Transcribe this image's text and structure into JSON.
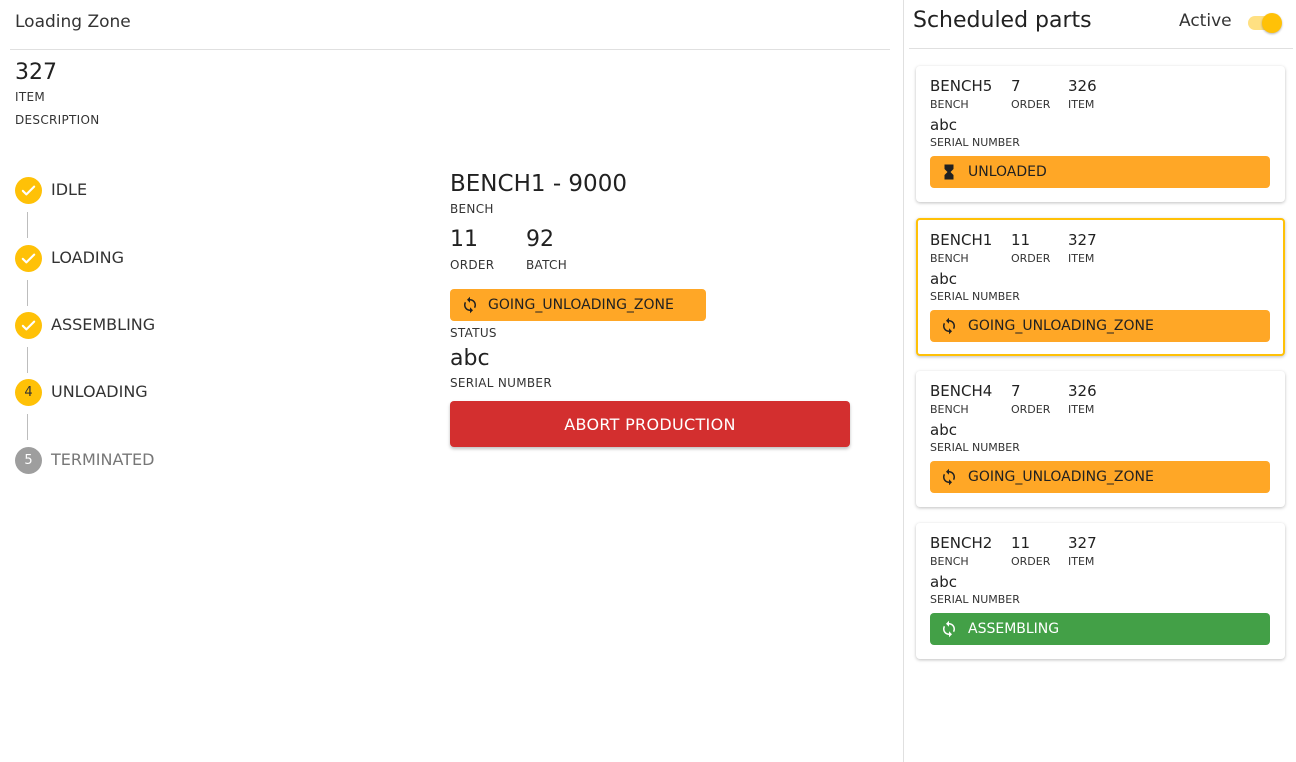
{
  "zone": {
    "title": "Loading Zone",
    "item_number": "327",
    "item_label": "ITEM",
    "description_label": "DESCRIPTION"
  },
  "steps": [
    {
      "label": "IDLE",
      "state": "done",
      "icon": "check-icon"
    },
    {
      "label": "LOADING",
      "state": "done",
      "icon": "check-icon"
    },
    {
      "label": "ASSEMBLING",
      "state": "done",
      "icon": "check-icon"
    },
    {
      "label": "UNLOADING",
      "state": "active",
      "number": "4"
    },
    {
      "label": "TERMINATED",
      "state": "pending",
      "number": "5"
    }
  ],
  "details": {
    "bench_title": "BENCH1 - 9000",
    "bench_label": "BENCH",
    "order_value": "11",
    "order_label": "ORDER",
    "batch_value": "92",
    "batch_label": "BATCH",
    "status_value": "GOING_UNLOADING_ZONE",
    "status_icon": "sync-icon",
    "status_label": "STATUS",
    "serial_value": "abc",
    "serial_label": "SERIAL NUMBER",
    "abort_label": "ABORT PRODUCTION"
  },
  "scheduled": {
    "title": "Scheduled parts",
    "active_label": "Active",
    "active_on": true,
    "cards": [
      {
        "bench": "BENCH5",
        "bench_label": "BENCH",
        "order": "7",
        "order_label": "ORDER",
        "item": "326",
        "item_label": "ITEM",
        "serial": "abc",
        "serial_label": "SERIAL NUMBER",
        "status": "UNLOADED",
        "status_icon": "hourglass-icon",
        "selected": false
      },
      {
        "bench": "BENCH1",
        "bench_label": "BENCH",
        "order": "11",
        "order_label": "ORDER",
        "item": "327",
        "item_label": "ITEM",
        "serial": "abc",
        "serial_label": "SERIAL NUMBER",
        "status": "GOING_UNLOADING_ZONE",
        "status_icon": "sync-icon",
        "selected": true
      },
      {
        "bench": "BENCH4",
        "bench_label": "BENCH",
        "order": "7",
        "order_label": "ORDER",
        "item": "326",
        "item_label": "ITEM",
        "serial": "abc",
        "serial_label": "SERIAL NUMBER",
        "status": "GOING_UNLOADING_ZONE",
        "status_icon": "sync-icon",
        "selected": false
      },
      {
        "bench": "BENCH2",
        "bench_label": "BENCH",
        "order": "11",
        "order_label": "ORDER",
        "item": "327",
        "item_label": "ITEM",
        "serial": "abc",
        "serial_label": "SERIAL NUMBER",
        "status": "ASSEMBLING",
        "status_icon": "sync-icon",
        "selected": false
      }
    ]
  },
  "colors": {
    "accent": "#ffc107",
    "status_orange": "#ffa726",
    "status_green": "#43a047",
    "danger": "#d32f2f"
  }
}
